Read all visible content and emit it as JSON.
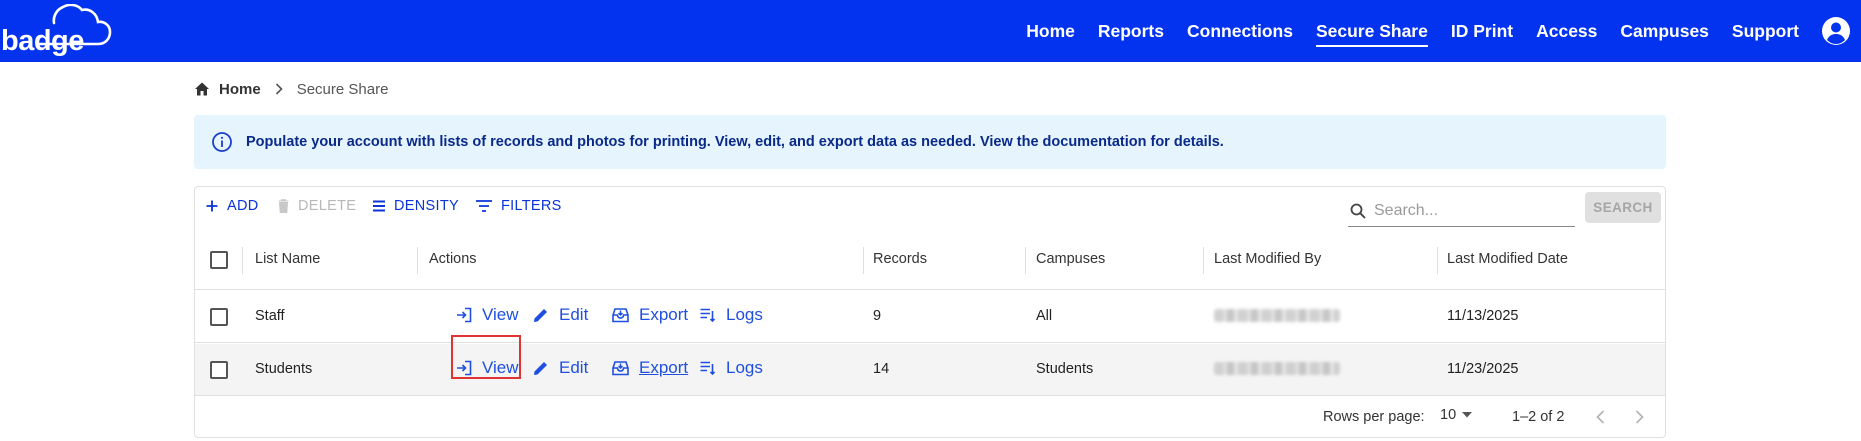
{
  "app": {
    "logo_text": "badge"
  },
  "nav": {
    "items": [
      {
        "label": "Home"
      },
      {
        "label": "Reports"
      },
      {
        "label": "Connections"
      },
      {
        "label": "Secure Share",
        "active": true
      },
      {
        "label": "ID Print"
      },
      {
        "label": "Access"
      },
      {
        "label": "Campuses"
      },
      {
        "label": "Support"
      }
    ],
    "avatar_icon": "account-circle-icon"
  },
  "breadcrumb": {
    "home": "Home",
    "current": "Secure Share"
  },
  "info_banner": {
    "text": "Populate your account with lists of records and photos for printing. View, edit, and export data as needed. View the documentation for details."
  },
  "toolbar": {
    "add": "ADD",
    "delete": "DELETE",
    "density": "DENSITY",
    "filters": "FILTERS",
    "search_placeholder": "Search...",
    "search_button": "SEARCH"
  },
  "table": {
    "headers": {
      "list_name": "List Name",
      "actions": "Actions",
      "records": "Records",
      "campuses": "Campuses",
      "last_modified_by": "Last Modified By",
      "last_modified_date": "Last Modified Date"
    },
    "action_labels": {
      "view": "View",
      "edit": "Edit",
      "export": "Export",
      "logs": "Logs"
    },
    "rows": [
      {
        "list_name": "Staff",
        "records": "9",
        "campuses": "All",
        "last_modified_date": "11/13/2025"
      },
      {
        "list_name": "Students",
        "records": "14",
        "campuses": "Students",
        "last_modified_date": "11/23/2025"
      }
    ]
  },
  "footer": {
    "rows_per_page_label": "Rows per page:",
    "rows_per_page_value": "10",
    "range": "1–2 of 2"
  },
  "colors": {
    "brand": "#0433f0",
    "link": "#1f4fe0",
    "info_bg": "#e5f4fd",
    "highlight": "#e03434"
  }
}
